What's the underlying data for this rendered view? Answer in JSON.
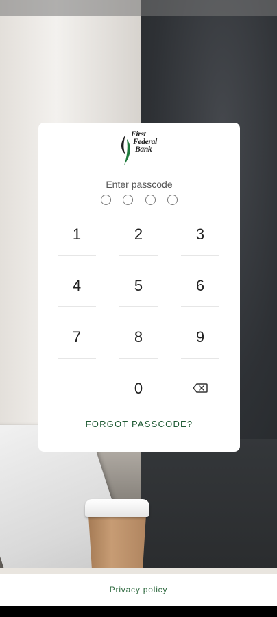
{
  "brand": {
    "logo_lines": [
      "First",
      "Federal",
      "Bank"
    ],
    "accent_color": "#1f5a34"
  },
  "passcode": {
    "prompt": "Enter passcode",
    "digits_entered": 0,
    "digits_total": 4
  },
  "keypad": {
    "keys": [
      "1",
      "2",
      "3",
      "4",
      "5",
      "6",
      "7",
      "8",
      "9",
      "0"
    ],
    "backspace_icon": "backspace-icon"
  },
  "forgot_label": "FORGOT PASSCODE?",
  "footer": {
    "privacy_label": "Privacy policy"
  }
}
